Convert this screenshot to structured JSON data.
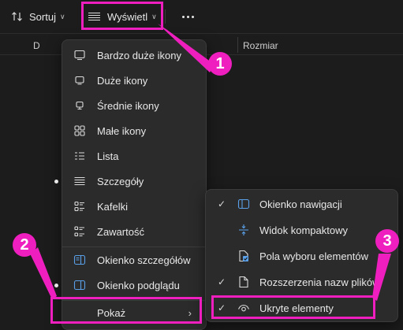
{
  "toolbar": {
    "sort_label": "Sortuj",
    "view_label": "Wyświetl",
    "more_icon": "more-icon"
  },
  "columns": {
    "col1": "D",
    "col2": "Rozmiar"
  },
  "view_menu": {
    "items": [
      {
        "label": "Bardzo duże ikony",
        "icon": "extra-large-icons-icon",
        "selected": false
      },
      {
        "label": "Duże ikony",
        "icon": "large-icons-icon",
        "selected": false
      },
      {
        "label": "Średnie ikony",
        "icon": "medium-icons-icon",
        "selected": false
      },
      {
        "label": "Małe ikony",
        "icon": "small-icons-icon",
        "selected": false
      },
      {
        "label": "Lista",
        "icon": "list-icon",
        "selected": false
      },
      {
        "label": "Szczegóły",
        "icon": "details-icon",
        "selected": true
      },
      {
        "label": "Kafelki",
        "icon": "tiles-icon",
        "selected": false
      },
      {
        "label": "Zawartość",
        "icon": "content-icon",
        "selected": false
      },
      {
        "label": "Okienko szczegółów",
        "icon": "details-pane-icon",
        "selected": false
      },
      {
        "label": "Okienko podglądu",
        "icon": "preview-pane-icon",
        "selected": true
      },
      {
        "label": "Pokaż",
        "icon": "chevron-right-icon",
        "selected": false
      }
    ]
  },
  "show_submenu": {
    "items": [
      {
        "label": "Okienko nawigacji",
        "checked": true,
        "icon": "navigation-pane-icon"
      },
      {
        "label": "Widok kompaktowy",
        "checked": false,
        "icon": "compact-view-icon"
      },
      {
        "label": "Pola wyboru elementów",
        "checked": false,
        "icon": "checkboxes-icon"
      },
      {
        "label": "Rozszerzenia nazw plików",
        "checked": true,
        "icon": "file-extensions-icon"
      },
      {
        "label": "Ukryte elementy",
        "checked": true,
        "icon": "eye-icon"
      }
    ]
  },
  "annotations": {
    "badge1": "1",
    "badge2": "2",
    "badge3": "3",
    "color": "#ef1fbf"
  },
  "colors": {
    "background": "#1c1c1c",
    "menu": "#2b2b2b",
    "text": "#e8e8e8"
  }
}
